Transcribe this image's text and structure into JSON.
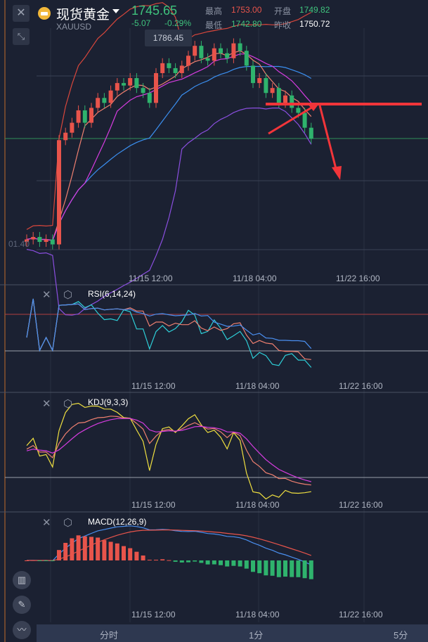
{
  "header": {
    "name": "现货黄金",
    "symbol": "XAUUSD",
    "price": "1745.65",
    "change": "-5.07",
    "change_pct": "-0.29%",
    "high_label": "最高",
    "high": "1753.00",
    "open_label": "开盘",
    "open": "1749.82",
    "low_label": "最低",
    "low": "1742.80",
    "prev_label": "昨收",
    "prev": "1750.72"
  },
  "icons": {
    "close": "close-icon",
    "collapse": "collapse-icon",
    "candle": "candlestick-icon",
    "draw": "pen-icon",
    "indicator": "indicator-icon"
  },
  "tooltip": "1786.45",
  "axis_label": "01.40",
  "time_labels": [
    "11/15 12:00",
    "11/18 04:00",
    "11/22 16:00"
  ],
  "indicators": {
    "rsi": "RSI(6,14,24)",
    "kdj": "KDJ(9,3,3)",
    "macd": "MACD(12,26,9)"
  },
  "tabs": [
    "分时",
    "1分",
    "5分"
  ],
  "colors": {
    "up": "#e8544b",
    "down": "#2fb36d",
    "bg": "#1b2132",
    "arrow": "#f2353a"
  },
  "chart_data": {
    "type": "candlestick",
    "price_range": [
      1690,
      1790
    ],
    "close": [
      1705,
      1706,
      1704,
      1705,
      1703,
      1745,
      1748,
      1752,
      1757,
      1752,
      1758,
      1762,
      1760,
      1765,
      1768,
      1767,
      1770,
      1766,
      1764,
      1760,
      1772,
      1776,
      1774,
      1772,
      1775,
      1779,
      1783,
      1778,
      1777,
      1782,
      1780,
      1778,
      1784,
      1781,
      1775,
      1768,
      1770,
      1764,
      1766,
      1760,
      1763,
      1758,
      1756,
      1750,
      1745.65
    ]
  }
}
